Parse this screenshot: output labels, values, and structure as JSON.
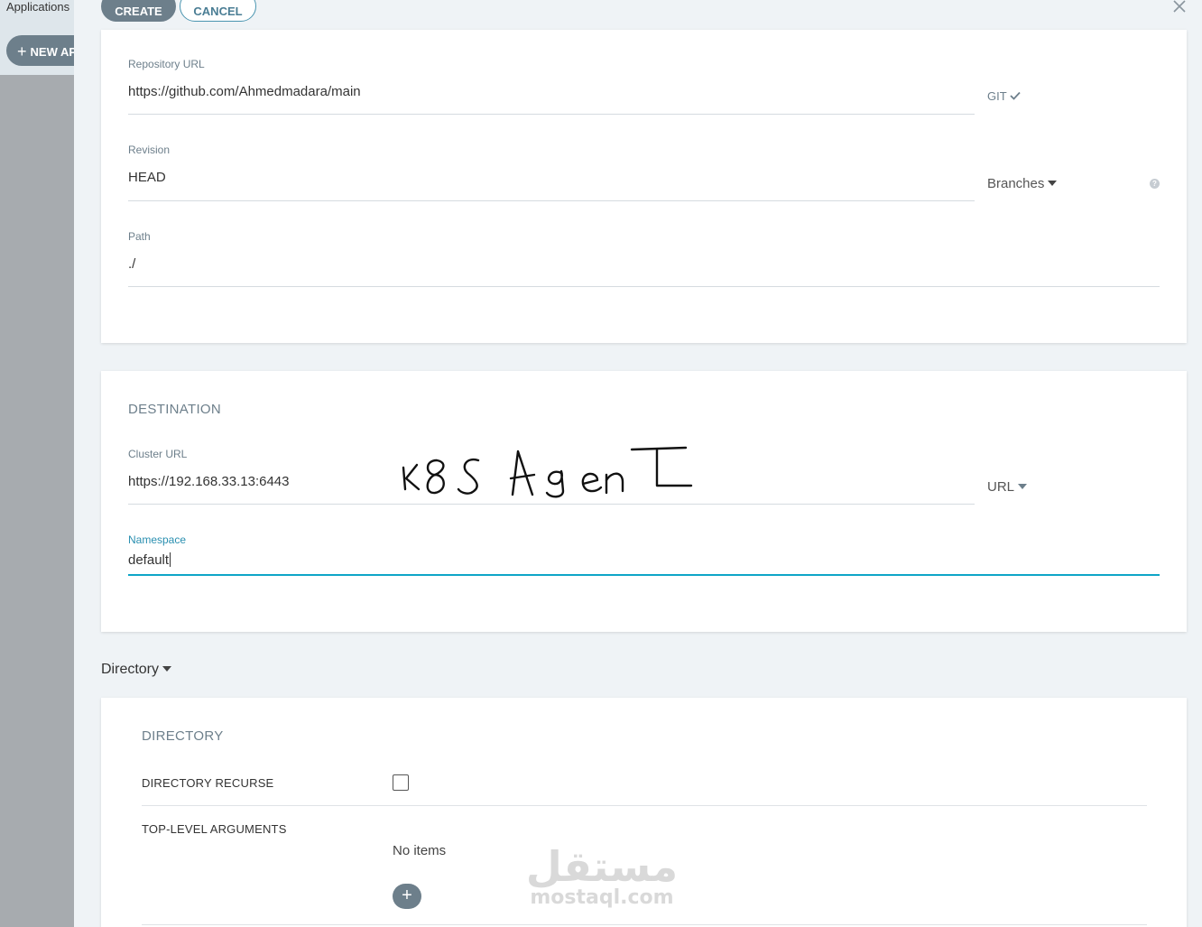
{
  "background": {
    "applications_label": "Applications",
    "new_app_label": "NEW AP"
  },
  "toolbar": {
    "create_label": "CREATE",
    "cancel_label": "CANCEL",
    "close_icon": "close-icon"
  },
  "source": {
    "repo_url_label": "Repository URL",
    "repo_url_value": "https://github.com/Ahmedmadara/main",
    "repo_type": "GIT",
    "revision_label": "Revision",
    "revision_value": "HEAD",
    "revision_selector": "Branches",
    "path_label": "Path",
    "path_value": "./"
  },
  "destination": {
    "title": "DESTINATION",
    "cluster_url_label": "Cluster URL",
    "cluster_url_value": "https://192.168.33.13:6443",
    "cluster_selector": "URL",
    "namespace_label": "Namespace",
    "namespace_value": "default",
    "annotation": "k8s AgenT"
  },
  "directory": {
    "toggle_label": "Directory",
    "title": "DIRECTORY",
    "recurse_label": "DIRECTORY RECURSE",
    "recurse_checked": false,
    "top_level_args_label": "TOP-LEVEL ARGUMENTS",
    "no_items_text": "No items",
    "add_icon": "plus-icon"
  },
  "watermark": {
    "arabic": "مستقل",
    "latin": "mostaql.com"
  },
  "colors": {
    "accent": "#0ea5c7",
    "button_grey": "#6d7f8b",
    "panel_bg": "#eff3f6"
  }
}
